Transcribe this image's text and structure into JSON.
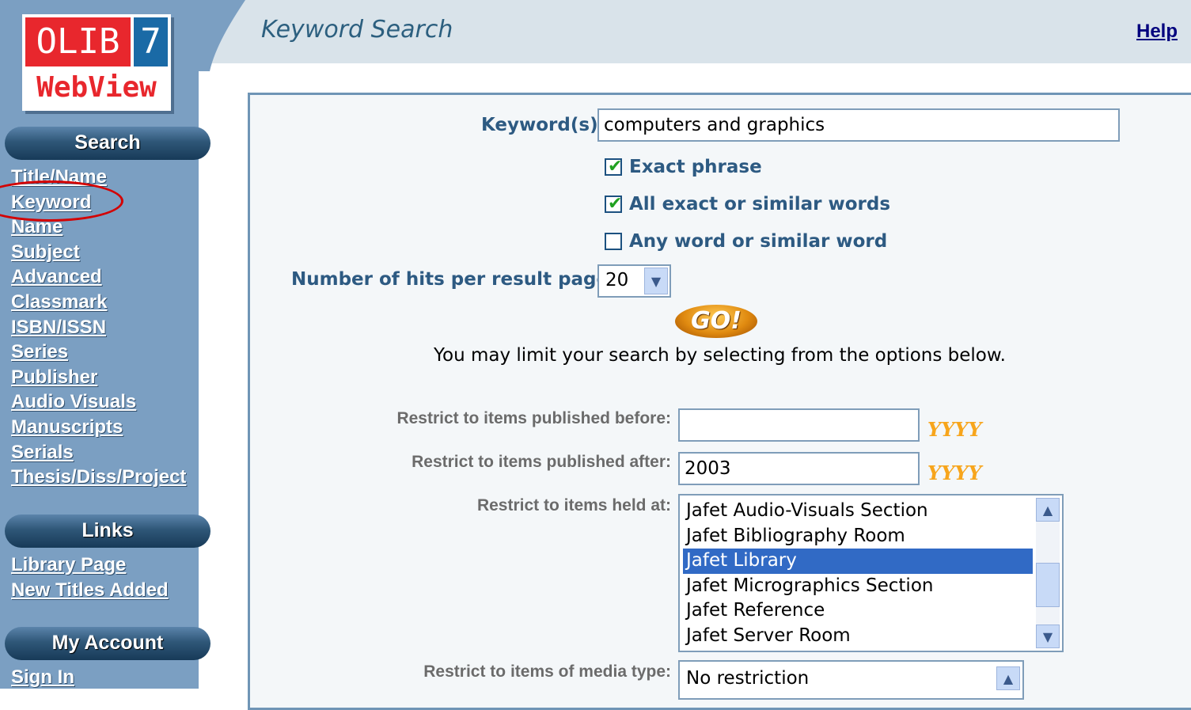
{
  "logo": {
    "brand": "OLIB",
    "version": "7",
    "product": "WebView"
  },
  "header": {
    "title": "Keyword Search",
    "help_label": "Help"
  },
  "sidebar": {
    "search_heading": "Search",
    "search_links": [
      "Title/Name",
      "Keyword",
      "Name",
      "Subject",
      "Advanced",
      "Classmark",
      "ISBN/ISSN",
      "Series",
      "Publisher",
      "Audio Visuals",
      "Manuscripts",
      "Serials",
      "Thesis/Diss/Project"
    ],
    "links_heading": "Links",
    "links": [
      "Library Page",
      "New Titles Added"
    ],
    "account_heading": "My Account",
    "account_links": [
      "Sign In"
    ]
  },
  "form": {
    "keyword_label": "Keyword(s)",
    "keyword_value": "computers and graphics",
    "options": [
      {
        "label": "Exact phrase",
        "checked": true
      },
      {
        "label": "All exact or similar words",
        "checked": true
      },
      {
        "label": "Any word or similar word",
        "checked": false
      }
    ],
    "hits_label": "Number of hits per result page",
    "hits_value": "20",
    "go_label": "GO!",
    "limit_text": "You may limit your search by selecting from the options below.",
    "before_label": "Restrict to items published before:",
    "before_value": "",
    "after_label": "Restrict to items published after:",
    "after_value": "2003",
    "year_hint": "YYYY",
    "held_label": "Restrict to items held at:",
    "held_options": [
      "Jafet Audio-Visuals Section",
      "Jafet Bibliography Room",
      "Jafet Library",
      "Jafet Micrographics Section",
      "Jafet Reference",
      "Jafet Server Room"
    ],
    "held_selected": "Jafet Library",
    "media_label": "Restrict to items of media type:",
    "media_value": "No restriction"
  }
}
